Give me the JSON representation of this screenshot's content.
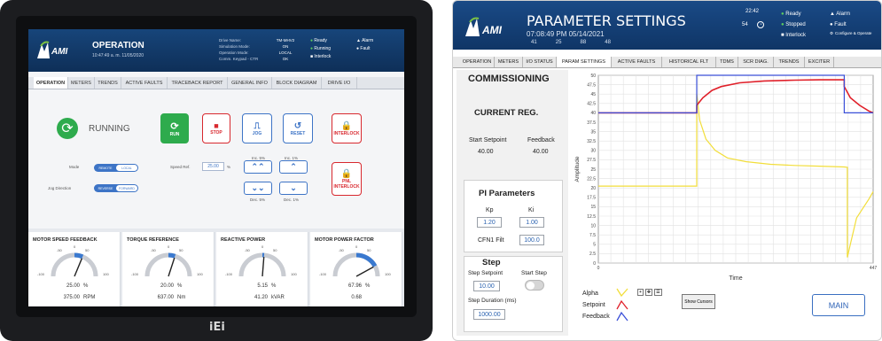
{
  "left": {
    "header": {
      "app": "AMI",
      "title": "OPERATION",
      "datetime": "10:47:49 a. m. 11/05/2020",
      "info_labels": [
        "Drive Name:",
        "Simulation Mode:",
        "Operation Mode:",
        "Comm. Keypad - CTR"
      ],
      "info_values": [
        "TM-MHV2",
        "ON",
        "LOCAL",
        "OK"
      ],
      "status": [
        "Ready",
        "Running",
        "Interlock"
      ],
      "alarms": [
        "Alarm",
        "Fault"
      ]
    },
    "tabs": [
      "OPERATION",
      "METERS",
      "TRENDS",
      "ACTIVE FAULTS",
      "TRACEBACK REPORT",
      "GENERAL INFO",
      "BLOCK DIAGRAM",
      "DRIVE I/O"
    ],
    "state": "RUNNING",
    "buttons": {
      "run": "RUN",
      "stop": "STOP",
      "jog": "JOG",
      "reset": "RESET",
      "interlock": "INTERLOCK",
      "pnl_interlock": "PNL INTERLOCK"
    },
    "mode_label": "Mode",
    "mode_opts": [
      "REMOTE",
      "LOCAL"
    ],
    "jog_label": "Jog Direction",
    "jog_opts": [
      "REVERSE",
      "FORWARD"
    ],
    "speed_ref_label": "Speed Ref.",
    "speed_ref": "25.00",
    "speed_ref_unit": "%",
    "inc5": "Inc. 5%",
    "inc1": "Inc. 1%",
    "dec5": "Dec. 5%",
    "dec1": "Dec. 1%",
    "gauges": [
      {
        "title": "MOTOR SPEED FEEDBACK",
        "pct": "25.00",
        "pct_unit": "%",
        "val": "375.00",
        "unit": "RPM",
        "needle": 25
      },
      {
        "title": "TORQUE REFERENCE",
        "pct": "20.00",
        "pct_unit": "%",
        "val": "637.00",
        "unit": "Nm",
        "needle": 20
      },
      {
        "title": "REACTIVE POWER",
        "pct": "5.15",
        "pct_unit": "%",
        "val": "41.20",
        "unit": "kVAR",
        "needle": 5
      },
      {
        "title": "MOTOR POWER FACTOR",
        "pct": "67.96",
        "pct_unit": "%",
        "val": "0.68",
        "unit": "",
        "needle": 68
      }
    ],
    "gauge_ticks": [
      "-100",
      "-50",
      "0",
      "50",
      "100"
    ],
    "brand": "iEi"
  },
  "right": {
    "header": {
      "app": "AMI",
      "title": "PARAMETER SETTINGS",
      "datetime": "07:08:49 PM  05/14/2021",
      "nums": [
        "41",
        "25",
        "88",
        "48"
      ],
      "time": "22:42",
      "code": "54",
      "status": [
        "Ready",
        "Stopped",
        "Interlock"
      ],
      "alarms": [
        "Alarm",
        "Fault"
      ],
      "configure": "Configure & Operate"
    },
    "tabs": [
      "OPERATION",
      "METERS",
      "I/O STATUS",
      "PARAM SETTINGS",
      "ACTIVE FAULTS",
      "HISTORICAL FLT",
      "TDMS",
      "SCR DIAG.",
      "TRENDS",
      "EXCITER"
    ],
    "commissioning": "COMMISSIONING",
    "current_reg": "CURRENT REG.",
    "start_setpoint_label": "Start Setpoint",
    "feedback_label": "Feedback",
    "start_setpoint": "40.00",
    "feedback": "40.00",
    "pi_title": "PI Parameters",
    "kp_label": "Kp",
    "ki_label": "Ki",
    "kp": "1.20",
    "ki": "1.00",
    "cfn_label": "CFN1 Filt",
    "cfn": "100.0",
    "step_title": "Step",
    "step_setpoint_label": "Step Setpoint",
    "start_step_label": "Start Step",
    "step_setpoint": "10.00",
    "step_duration_label": "Step Duration (ms)",
    "step_duration": "1000.00",
    "legend": [
      "Alpha",
      "Setpoint",
      "Feedback"
    ],
    "show_cursors": "Show Cursors",
    "main": "MAIN",
    "colors": {
      "alpha": "#f2de3a",
      "setpoint": "#e0202a",
      "feedback": "#3a4fd8"
    }
  },
  "chart_data": {
    "type": "line",
    "title": "",
    "xlabel": "Time",
    "ylabel": "Amplitude",
    "xlim": [
      0,
      447
    ],
    "ylim": [
      0,
      50
    ],
    "yticks": [
      0,
      2.5,
      5,
      7.5,
      10,
      12.5,
      15,
      17.5,
      20,
      22.5,
      25,
      27.5,
      30,
      32.5,
      35,
      37.5,
      40,
      42.5,
      45,
      47.5,
      50
    ],
    "xticks": [
      "0",
      "447"
    ],
    "series": [
      {
        "name": "Alpha",
        "x": [
          0,
          160,
          160,
          165,
          175,
          190,
          210,
          240,
          280,
          320,
          360,
          400,
          405,
          405,
          410,
          420,
          440,
          447
        ],
        "y": [
          20.5,
          20.5,
          45,
          38,
          33,
          30,
          28,
          27,
          26.3,
          26,
          25.8,
          25.6,
          25.5,
          1.5,
          5,
          12,
          17,
          19
        ]
      },
      {
        "name": "Setpoint",
        "x": [
          0,
          160,
          160,
          170,
          185,
          200,
          230,
          270,
          320,
          360,
          400,
          400,
          410,
          425,
          440,
          447
        ],
        "y": [
          40,
          40,
          42,
          44,
          46,
          47,
          48,
          48.5,
          48.7,
          48.8,
          48.8,
          47,
          44,
          42,
          40.5,
          40
        ]
      },
      {
        "name": "Feedback",
        "x": [
          0,
          160,
          160,
          400,
          400,
          447
        ],
        "y": [
          40,
          40,
          50,
          50,
          40,
          40
        ]
      }
    ]
  }
}
